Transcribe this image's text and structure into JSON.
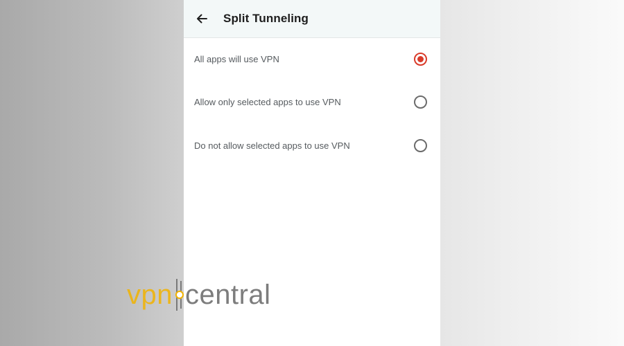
{
  "header": {
    "title": "Split Tunneling",
    "back_icon": "arrow-left-icon"
  },
  "options": [
    {
      "label": "All apps will use VPN",
      "selected": true
    },
    {
      "label": "Allow only selected apps to use VPN",
      "selected": false
    },
    {
      "label": "Do not allow selected apps to use VPN",
      "selected": false
    }
  ],
  "watermark": {
    "part1": "vpn",
    "part2": "central"
  },
  "colors": {
    "accent": "#d93b2a",
    "header_bg": "#f3f8f8",
    "watermark_yellow": "#f2b300"
  }
}
